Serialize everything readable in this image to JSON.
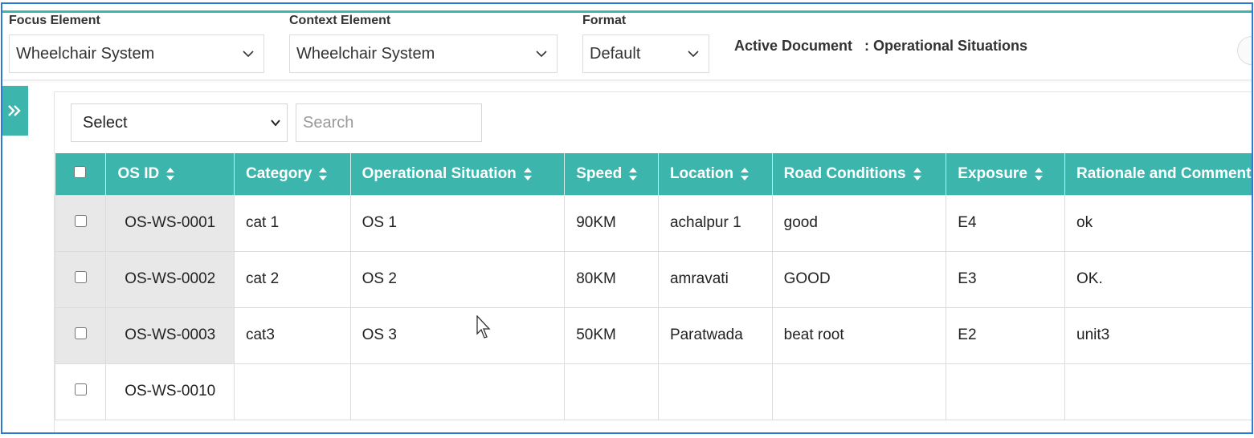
{
  "filters": {
    "focus": {
      "label": "Focus Element",
      "value": "Wheelchair System"
    },
    "context": {
      "label": "Context Element",
      "value": "Wheelchair System"
    },
    "format": {
      "label": "Format",
      "value": "Default"
    },
    "active_document": {
      "label": "Active Document",
      "value": ": Operational Situations"
    }
  },
  "toolbar": {
    "column_select": "Select",
    "search_placeholder": "Search"
  },
  "table": {
    "columns": [
      "OS ID",
      "Category",
      "Operational Situation",
      "Speed",
      "Location",
      "Road Conditions",
      "Exposure",
      "Rationale and Comment"
    ],
    "rows": [
      {
        "id": "OS-WS-0001",
        "category": "cat 1",
        "situation": "OS 1",
        "speed": "90KM",
        "location": "achalpur 1",
        "road": "good",
        "exposure": "E4",
        "rationale": "ok"
      },
      {
        "id": "OS-WS-0002",
        "category": "cat 2",
        "situation": "OS 2",
        "speed": "80KM",
        "location": "amravati",
        "road": "GOOD",
        "exposure": "E3",
        "rationale": "OK."
      },
      {
        "id": "OS-WS-0003",
        "category": "cat3",
        "situation": "OS 3",
        "speed": "50KM",
        "location": "Paratwada",
        "road": "beat root",
        "exposure": "E2",
        "rationale": "unit3"
      },
      {
        "id": "OS-WS-0010",
        "category": "",
        "situation": "",
        "speed": "",
        "location": "",
        "road": "",
        "exposure": "",
        "rationale": ""
      }
    ]
  },
  "icons": {
    "sidebar_toggle": "double-chevron-right-icon",
    "dropdown": "chevron-down-icon",
    "sort": "sort-icon"
  },
  "colors": {
    "accent": "#3cb5ad",
    "frame": "#2b7bd3"
  }
}
